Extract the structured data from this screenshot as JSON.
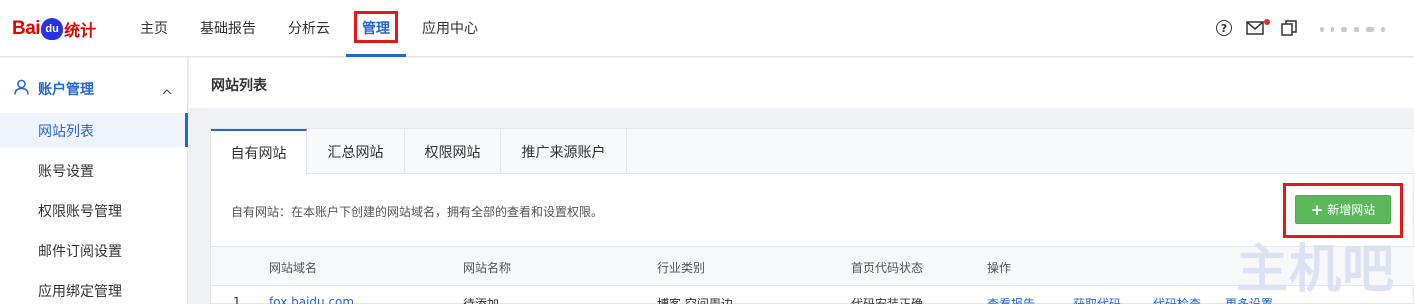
{
  "logo": {
    "bai": "Bai",
    "du": "du",
    "tongji": "统计"
  },
  "nav": [
    {
      "label": "主页"
    },
    {
      "label": "基础报告"
    },
    {
      "label": "分析云"
    },
    {
      "label": "管理"
    },
    {
      "label": "应用中心"
    }
  ],
  "header_icons": {
    "help": "?"
  },
  "sidebar": {
    "section": "账户管理",
    "items": [
      {
        "label": "网站列表"
      },
      {
        "label": "账号设置"
      },
      {
        "label": "权限账号管理"
      },
      {
        "label": "邮件订阅设置"
      },
      {
        "label": "应用绑定管理"
      }
    ]
  },
  "page": {
    "title": "网站列表"
  },
  "tabs": [
    {
      "label": "自有网站"
    },
    {
      "label": "汇总网站"
    },
    {
      "label": "权限网站"
    },
    {
      "label": "推广来源账户"
    }
  ],
  "description": "自有网站：在本账户下创建的网站域名，拥有全部的查看和设置权限。",
  "add_button": {
    "plus": "+",
    "label": "新增网站"
  },
  "table": {
    "headers": [
      "网站域名",
      "网站名称",
      "行业类别",
      "首页代码状态",
      "操作"
    ],
    "rows": [
      {
        "index": "1",
        "domain": "fox.baidu.com",
        "name": "待添加",
        "category": "博客 空间周边",
        "status": "代码安装正确",
        "actions": [
          "查看报告",
          "获取代码",
          "代码检查",
          "更多设置"
        ]
      }
    ]
  },
  "watermark": "主机吧"
}
